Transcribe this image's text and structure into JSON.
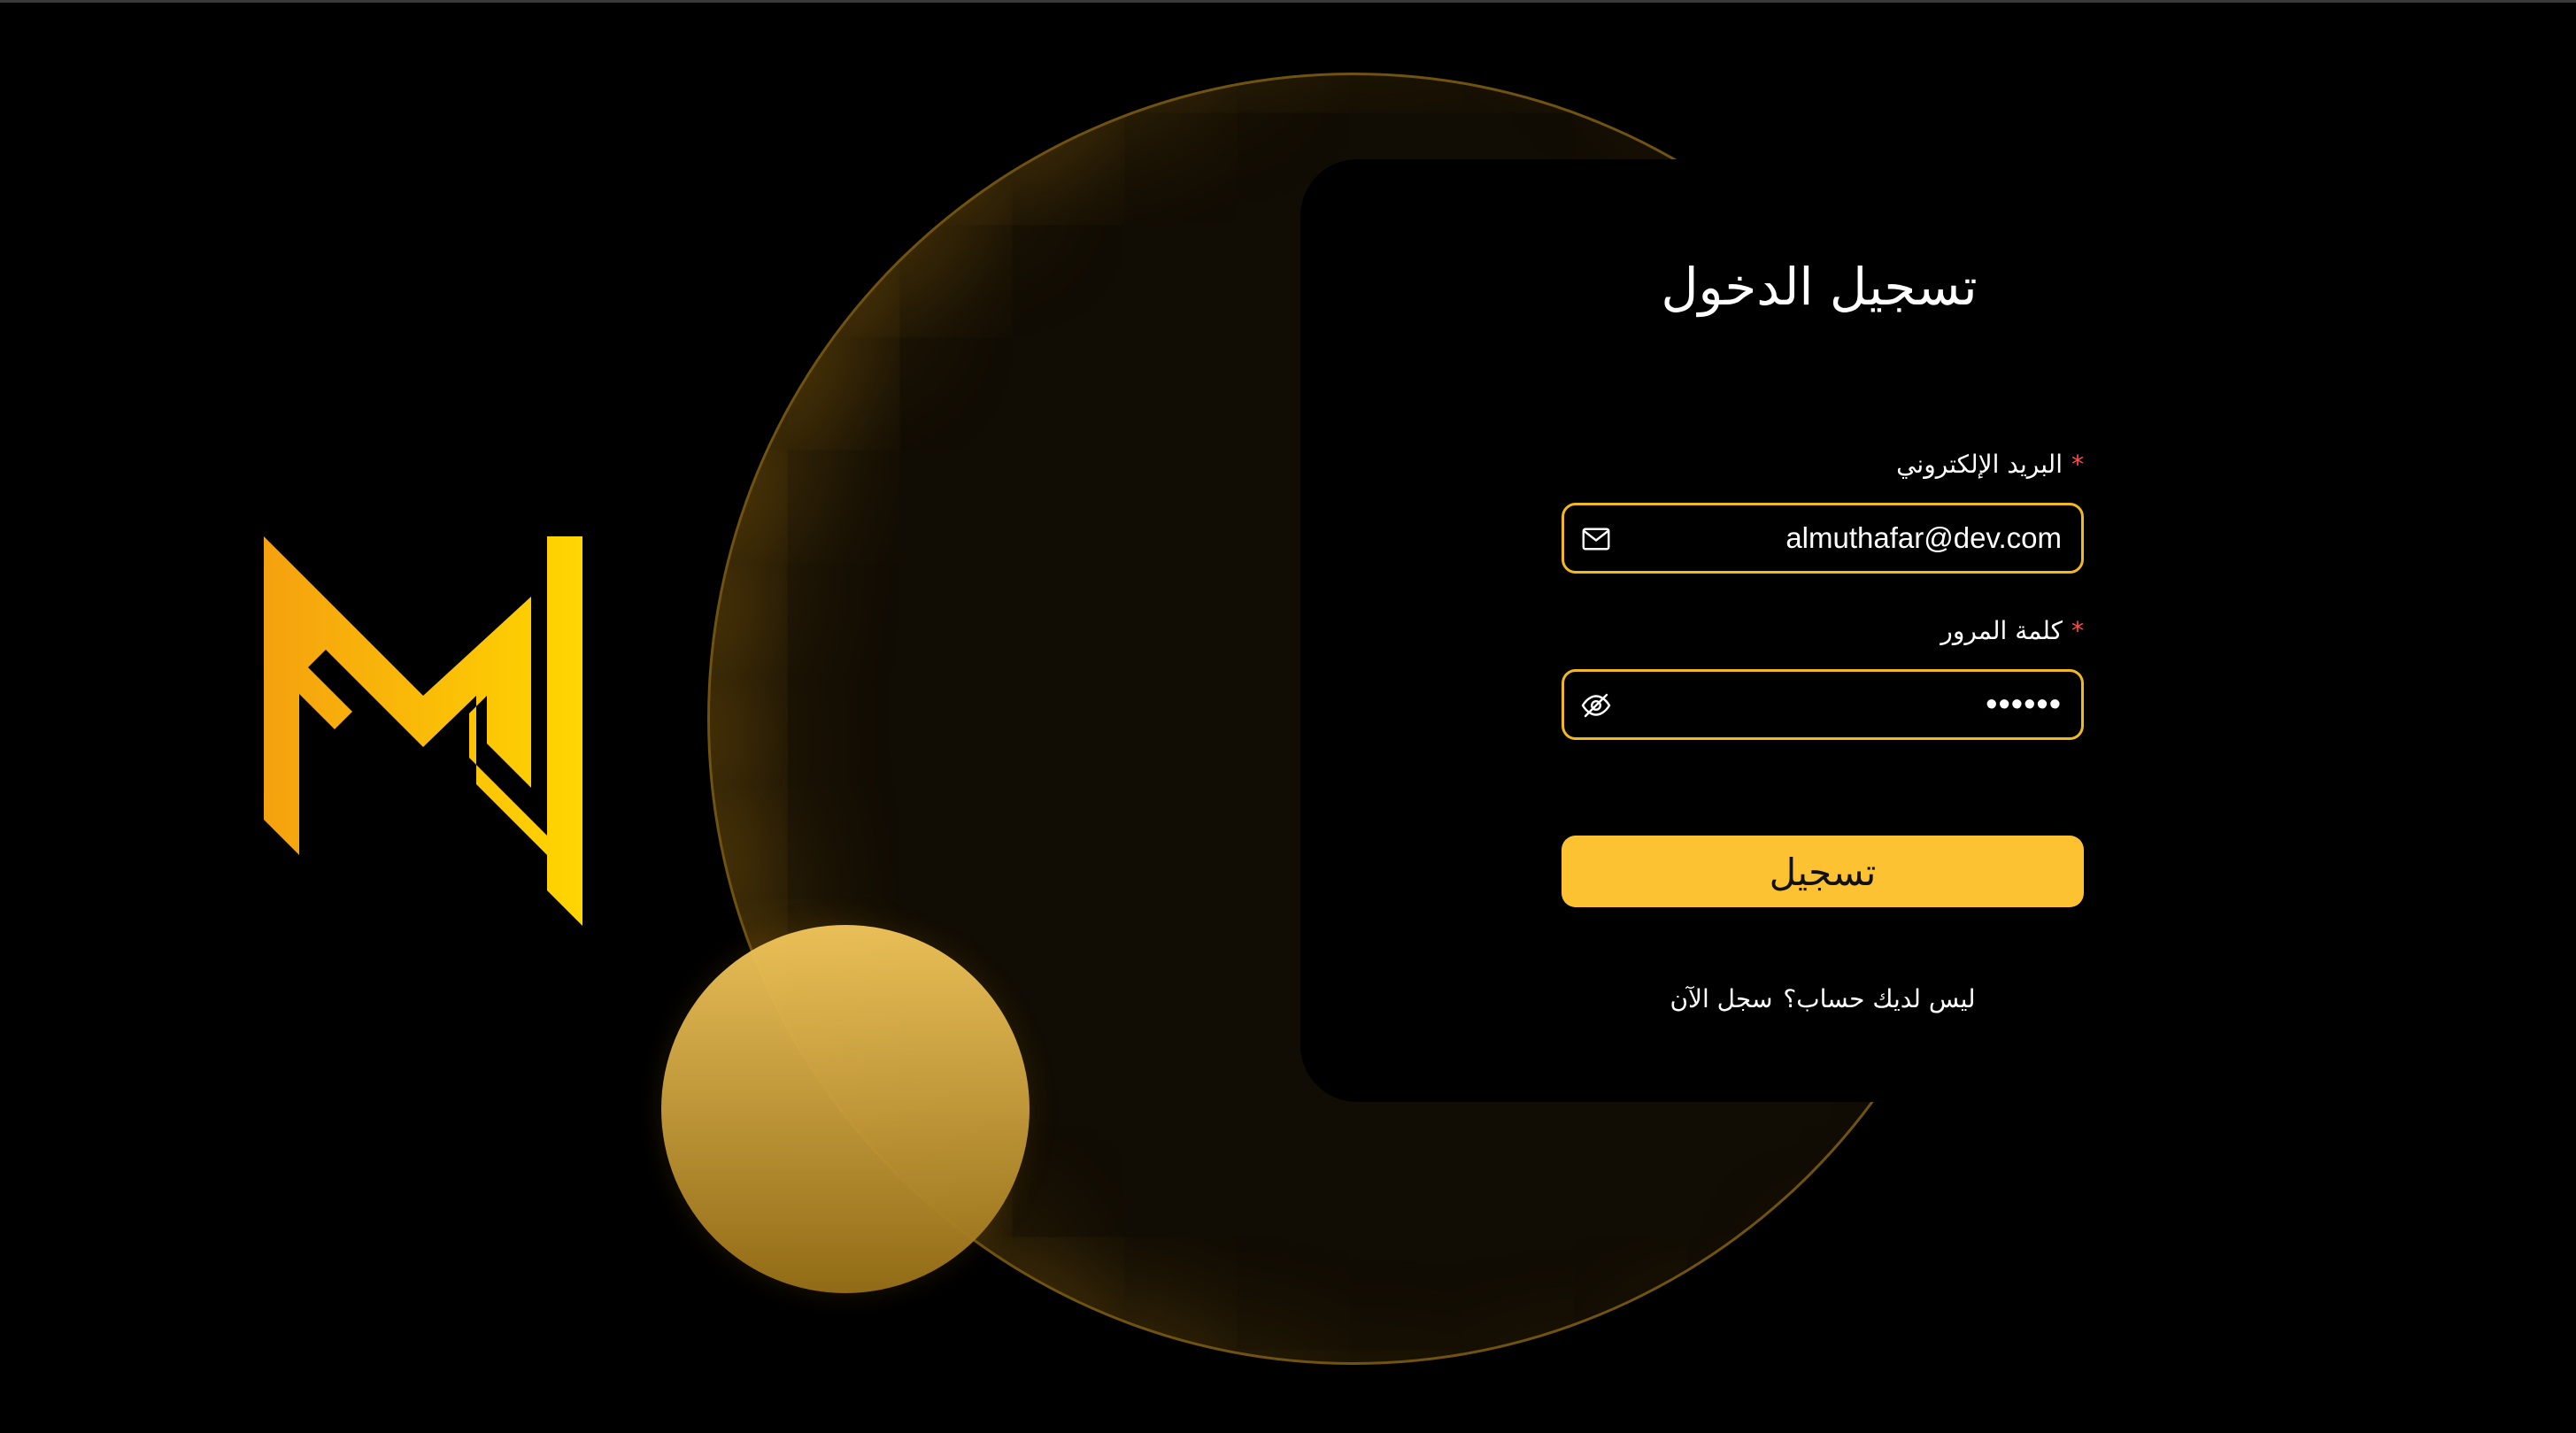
{
  "colors": {
    "background": "#000000",
    "accent": "#f2b91e",
    "button": "#fdc232",
    "required": "#ff4d4f",
    "logo_gradient": [
      "#f5a10f",
      "#ffd600"
    ]
  },
  "logo": {
    "icon": "m-monogram-logo"
  },
  "login": {
    "title": "تسجيل الدخول",
    "email": {
      "required_mark": "*",
      "label": "البريد الإلكتروني",
      "value": "almuthafar@dev.com",
      "icon": "mail-icon"
    },
    "password": {
      "required_mark": "*",
      "label": "كلمة المرور",
      "value": "••••••",
      "icon": "eye-off-icon"
    },
    "submit_label": "تسجيل",
    "footer": {
      "question": "ليس لديك حساب؟",
      "register_link": "سجل الآن"
    }
  }
}
